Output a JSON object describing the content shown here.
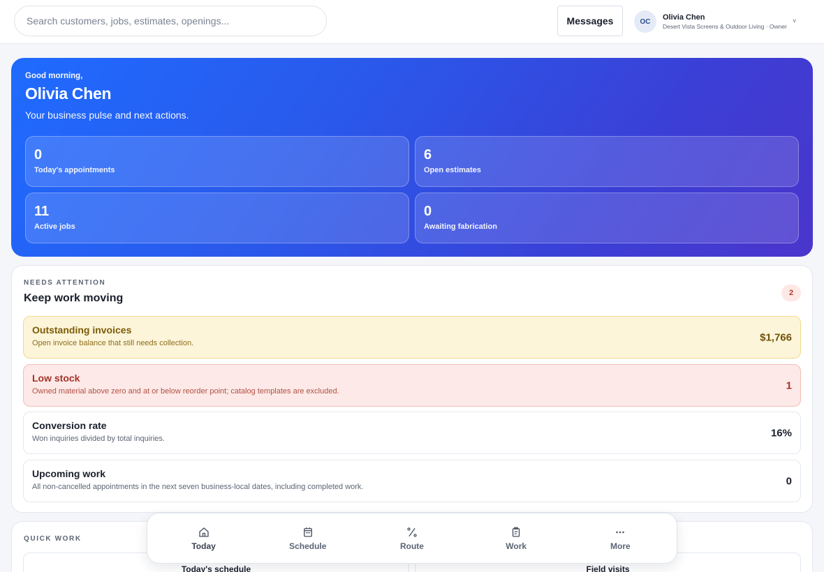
{
  "header": {
    "search_placeholder": "Search customers, jobs, estimates, openings...",
    "messages_label": "Messages",
    "user": {
      "initials": "OC",
      "name": "Olivia Chen",
      "subtitle": "Desert Vista Screens & Outdoor Living · Owner",
      "caret": "˅"
    }
  },
  "hero": {
    "greeting": "Good morning,",
    "name": "Olivia Chen",
    "subtitle": "Your business pulse and next actions.",
    "stats": [
      {
        "value": "0",
        "label": "Today's appointments"
      },
      {
        "value": "6",
        "label": "Open estimates"
      },
      {
        "value": "11",
        "label": "Active jobs"
      },
      {
        "value": "0",
        "label": "Awaiting fabrication"
      }
    ]
  },
  "attention": {
    "eyebrow": "NEEDS ATTENTION",
    "title": "Keep work moving",
    "count": "2",
    "items": [
      {
        "title": "Outstanding invoices",
        "desc": "Open invoice balance that still needs collection.",
        "value": "$1,766",
        "tone": "warn"
      },
      {
        "title": "Low stock",
        "desc": "Owned material above zero and at or below reorder point; catalog templates are excluded.",
        "value": "1",
        "tone": "danger"
      },
      {
        "title": "Conversion rate",
        "desc": "Won inquiries divided by total inquiries.",
        "value": "16%",
        "tone": "neutral"
      },
      {
        "title": "Upcoming work",
        "desc": "All non-cancelled appointments in the next seven business-local dates, including completed work.",
        "value": "0",
        "tone": "neutral"
      }
    ]
  },
  "quick_work": {
    "eyebrow": "QUICK WORK",
    "tiles": [
      "Today's schedule",
      "Field visits"
    ]
  },
  "bottom_nav": {
    "items": [
      {
        "label": "Today",
        "icon": "home-icon"
      },
      {
        "label": "Schedule",
        "icon": "calendar-icon"
      },
      {
        "label": "Route",
        "icon": "route-icon"
      },
      {
        "label": "Work",
        "icon": "clipboard-icon"
      },
      {
        "label": "More",
        "icon": "more-icon"
      }
    ]
  },
  "colors": {
    "hero_gradient_start": "#1f6bff",
    "hero_gradient_end": "#4a35cc",
    "warn_bg": "#fdf5d9",
    "danger_bg": "#fde9e7"
  }
}
